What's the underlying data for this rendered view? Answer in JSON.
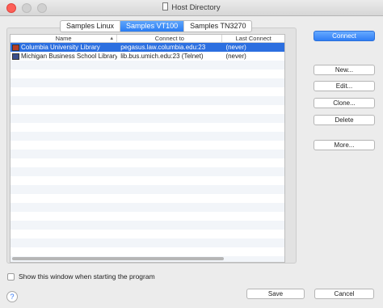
{
  "window": {
    "title": "Host Directory"
  },
  "tabs": [
    {
      "label": "Samples Linux",
      "active": false
    },
    {
      "label": "Samples VT100",
      "active": true
    },
    {
      "label": "Samples TN3270",
      "active": false
    }
  ],
  "table": {
    "columns": [
      "Name",
      "Connect to",
      "Last Connect"
    ],
    "rows": [
      {
        "name": "Columbia University Library",
        "connect_to": "pegasus.law.columbia.edu:23",
        "last_connect": "(never)",
        "icon": "terminal-red-icon",
        "selected": true
      },
      {
        "name": "Michigan Business School Library",
        "connect_to": "lib.bus.umich.edu:23 (Telnet)",
        "last_connect": "(never)",
        "icon": "terminal-blue-icon",
        "selected": false
      }
    ],
    "sort_icon": "sort-ascending-icon"
  },
  "buttons": {
    "connect": "Connect",
    "new": "New...",
    "edit": "Edit...",
    "clone": "Clone...",
    "delete": "Delete",
    "more": "More...",
    "save": "Save",
    "cancel": "Cancel"
  },
  "checkbox": {
    "label": "Show this window when starting the program",
    "checked": false
  },
  "help": {
    "glyph": "?"
  },
  "colors": {
    "accent": "#2f7ef5",
    "selection": "#2c6fe0",
    "close": "#fd5f57"
  }
}
